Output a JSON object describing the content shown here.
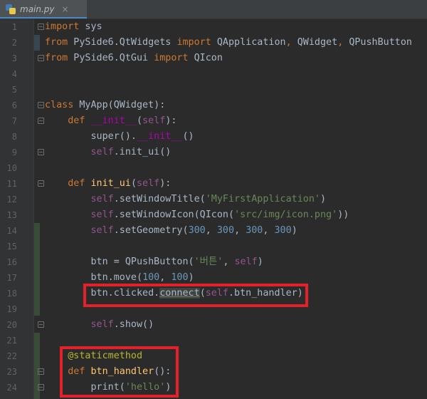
{
  "tab": {
    "filename": "main.py",
    "close": "×"
  },
  "line_numbers": [
    "1",
    "2",
    "3",
    "4",
    "5",
    "6",
    "7",
    "8",
    "9",
    "10",
    "11",
    "12",
    "13",
    "14",
    "15",
    "16",
    "17",
    "18",
    "19",
    "20",
    "21",
    "22",
    "23",
    "24"
  ],
  "code": {
    "l1": [
      "import",
      " sys"
    ],
    "l2": [
      "from",
      " PySide6.QtWidgets ",
      "import",
      " QApplication",
      ", ",
      "QWidget",
      ", ",
      "QPushButton"
    ],
    "l3": [
      "from",
      " PySide6.QtGui ",
      "import",
      " QIcon"
    ],
    "l6": [
      "class",
      " MyApp(QWidget):"
    ],
    "l7": [
      "    ",
      "def",
      " ",
      "__init__",
      "(",
      "self",
      "):"
    ],
    "l8": [
      "        super().",
      "__init__",
      "()"
    ],
    "l9": [
      "        ",
      "self",
      ".init_ui()"
    ],
    "l11": [
      "    ",
      "def",
      " ",
      "init_ui",
      "(",
      "self",
      "):"
    ],
    "l12": [
      "        ",
      "self",
      ".setWindowTitle(",
      "'MyFirstApplication'",
      ")"
    ],
    "l13": [
      "        ",
      "self",
      ".setWindowIcon(QIcon(",
      "'src/img/icon.png'",
      "))"
    ],
    "l14": [
      "        ",
      "self",
      ".setGeometry(",
      "300",
      ", ",
      "300",
      ", ",
      "300",
      ", ",
      "300",
      ")"
    ],
    "l16": [
      "        btn = QPushButton(",
      "'버튼'",
      ", ",
      "self",
      ")"
    ],
    "l17": [
      "        btn.move(",
      "100",
      ", ",
      "100",
      ")"
    ],
    "l18": [
      "        btn.clicked.",
      "connect",
      "(",
      "self",
      ".btn_handler)"
    ],
    "l20": [
      "        ",
      "self",
      ".show()"
    ],
    "l22": [
      "    ",
      "@staticmethod"
    ],
    "l23": [
      "    ",
      "def",
      " ",
      "btn_handler",
      "():"
    ],
    "l24": [
      "        print(",
      "'hello'",
      ")"
    ]
  },
  "colors": {
    "highlight_box": "#e4202a",
    "keyword": "#cc7832",
    "function": "#ffc66d",
    "self": "#94558d",
    "number": "#6897bb",
    "string": "#6a8759",
    "decorator": "#bbb529"
  }
}
